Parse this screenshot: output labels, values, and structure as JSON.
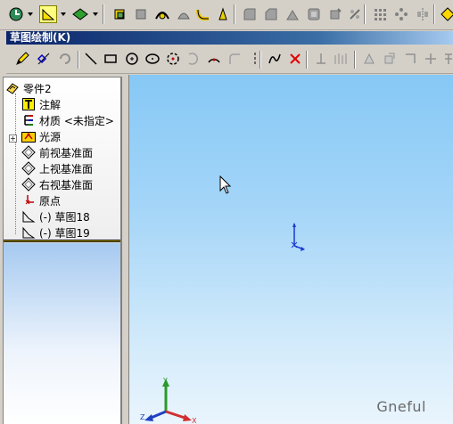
{
  "toolbar": {
    "icons": [
      "rebuild-icon",
      "sketch-icon",
      "features-icon"
    ]
  },
  "sketch_toolbar": {
    "title": "草图绘制(K)"
  },
  "feature_tree": {
    "root": "零件2",
    "items": [
      {
        "label": "注解",
        "icon": "annotation-icon"
      },
      {
        "label": "材质 <未指定>",
        "icon": "material-icon"
      },
      {
        "label": "光源",
        "icon": "lights-icon"
      },
      {
        "label": "前视基准面",
        "icon": "plane-icon"
      },
      {
        "label": "上视基准面",
        "icon": "plane-icon"
      },
      {
        "label": "右视基准面",
        "icon": "plane-icon"
      },
      {
        "label": "原点",
        "icon": "origin-icon"
      },
      {
        "label": "(-) 草图18",
        "icon": "sketch-icon"
      },
      {
        "label": "(-) 草图19",
        "icon": "sketch-icon"
      }
    ]
  },
  "graphics": {
    "watermark": "Gneful",
    "triad_labels": {
      "x": "X",
      "y": "Y",
      "z": "Z"
    }
  },
  "colors": {
    "title_bar": "#0a246a",
    "tree_divider": "#c8b400",
    "viewport_top": "#86c8f6"
  }
}
